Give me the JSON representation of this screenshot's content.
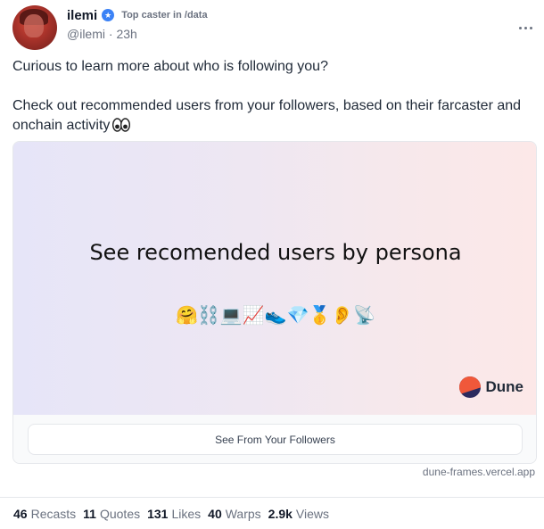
{
  "author": {
    "name": "ilemi",
    "badge_icon": "power-badge-icon",
    "top_caster_label": "Top caster in /data",
    "handle": "@ilemi",
    "separator": "·",
    "time_ago": "23h"
  },
  "post": {
    "line1": "Curious to learn more about who is following you?",
    "line2": "Check out recommended users from your followers, based on their farcaster and onchain activity",
    "eyes_icon": "eyes-emoji-icon"
  },
  "frame": {
    "heading": "See recomended users by persona",
    "emojis": "🤗⛓️💻📈👟💎🥇👂📡",
    "brand": "Dune",
    "button_label": "See From Your Followers",
    "domain": "dune-frames.vercel.app"
  },
  "stats": [
    {
      "count": "46",
      "label": "Recasts"
    },
    {
      "count": "11",
      "label": "Quotes"
    },
    {
      "count": "131",
      "label": "Likes"
    },
    {
      "count": "40",
      "label": "Warps"
    },
    {
      "count": "2.9k",
      "label": "Views"
    }
  ],
  "colors": {
    "badge": "#3b82f6",
    "dune_orange": "#f0583a",
    "dune_navy": "#2b2a5e",
    "muted_text": "#6b7280"
  }
}
